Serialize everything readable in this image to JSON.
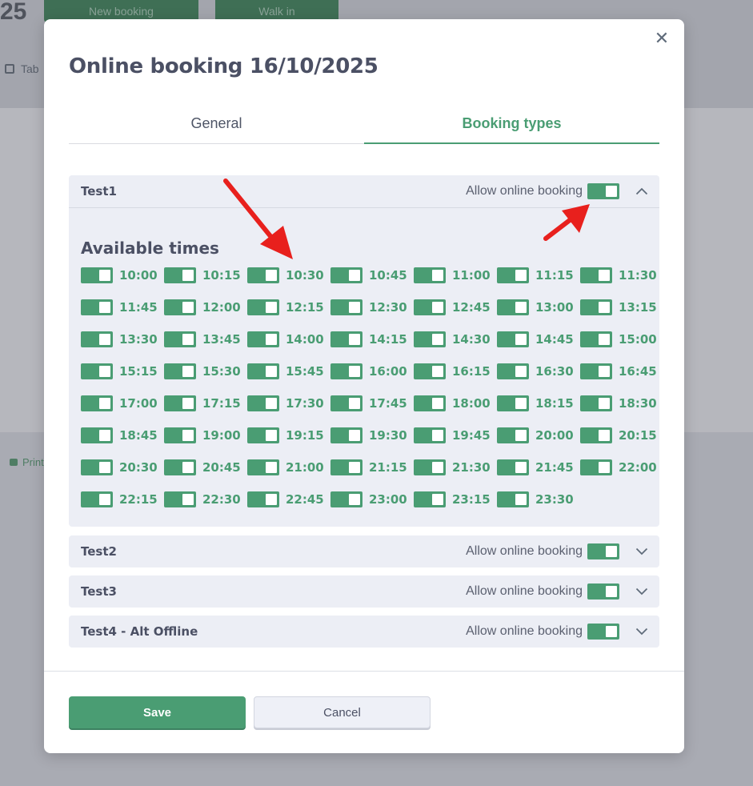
{
  "background": {
    "year_fragment": "25",
    "buttons": [
      "New booking",
      "Walk in"
    ],
    "tab_label": "Tab",
    "print_label": "Print"
  },
  "modal": {
    "title": "Online booking 16/10/2025",
    "close_glyph": "✕",
    "tabs": [
      {
        "label": "General",
        "active": false
      },
      {
        "label": "Booking types",
        "active": true
      }
    ]
  },
  "sections": [
    {
      "name": "Test1",
      "allow_label": "Allow online booking",
      "enabled": true,
      "expanded": true
    },
    {
      "name": "Test2",
      "allow_label": "Allow online booking",
      "enabled": true,
      "expanded": false
    },
    {
      "name": "Test3",
      "allow_label": "Allow online booking",
      "enabled": true,
      "expanded": false
    },
    {
      "name": "Test4 - Alt Offline",
      "allow_label": "Allow online booking",
      "enabled": true,
      "expanded": false
    }
  ],
  "available_times": {
    "title": "Available times",
    "slots": [
      "10:00",
      "10:15",
      "10:30",
      "10:45",
      "11:00",
      "11:15",
      "11:30",
      "11:45",
      "12:00",
      "12:15",
      "12:30",
      "12:45",
      "13:00",
      "13:15",
      "13:30",
      "13:45",
      "14:00",
      "14:15",
      "14:30",
      "14:45",
      "15:00",
      "15:15",
      "15:30",
      "15:45",
      "16:00",
      "16:15",
      "16:30",
      "16:45",
      "17:00",
      "17:15",
      "17:30",
      "17:45",
      "18:00",
      "18:15",
      "18:30",
      "18:45",
      "19:00",
      "19:15",
      "19:30",
      "19:45",
      "20:00",
      "20:15",
      "20:30",
      "20:45",
      "21:00",
      "21:15",
      "21:30",
      "21:45",
      "22:00",
      "22:15",
      "22:30",
      "22:45",
      "23:00",
      "23:15",
      "23:30"
    ]
  },
  "footer": {
    "save_label": "Save",
    "cancel_label": "Cancel"
  },
  "colors": {
    "accent": "#4a9d73",
    "annotation_arrow": "#e8201d"
  },
  "icons": [
    "close-icon",
    "chevron-up-icon",
    "chevron-down-icon"
  ]
}
